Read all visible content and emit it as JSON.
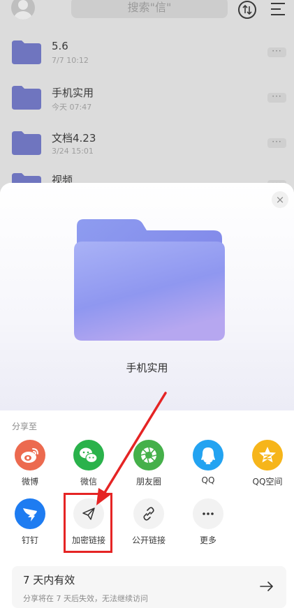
{
  "header": {
    "search_placeholder": "搜索\"信\""
  },
  "files": [
    {
      "name": "5.6",
      "date": "7/7 10:12",
      "more": "···"
    },
    {
      "name": "手机实用",
      "date": "今天 07:47",
      "more": "···"
    },
    {
      "name": "文档4.23",
      "date": "3/24 15:01",
      "more": "···"
    },
    {
      "name": "视频",
      "date": "",
      "more": "···"
    }
  ],
  "sheet": {
    "close": "×",
    "folder_title": "手机实用",
    "share_to": "分享至",
    "apps": [
      {
        "label": "微博",
        "icon": "weibo-icon",
        "color": "#ec6a4f"
      },
      {
        "label": "微信",
        "icon": "wechat-icon",
        "color": "#2ab24b"
      },
      {
        "label": "朋友圈",
        "icon": "moments-icon",
        "color": "#45b04a"
      },
      {
        "label": "QQ",
        "icon": "qq-icon",
        "color": "#23a3f1"
      },
      {
        "label": "QQ空间",
        "icon": "qzone-icon",
        "color": "#f6b51a"
      },
      {
        "label": "钉钉",
        "icon": "dingtalk-icon",
        "color": "#1e7cf1"
      },
      {
        "label": "加密链接",
        "icon": "send-icon",
        "color": "#f2f2f2"
      },
      {
        "label": "公开链接",
        "icon": "link-icon",
        "color": "#f2f2f2"
      },
      {
        "label": "更多",
        "icon": "more-icon",
        "color": "#f2f2f2"
      }
    ],
    "validity": {
      "title": "7 天内有效",
      "subtitle": "分享将在 7 天后失效，无法继续访问"
    }
  },
  "annotation_color": "#e52424"
}
